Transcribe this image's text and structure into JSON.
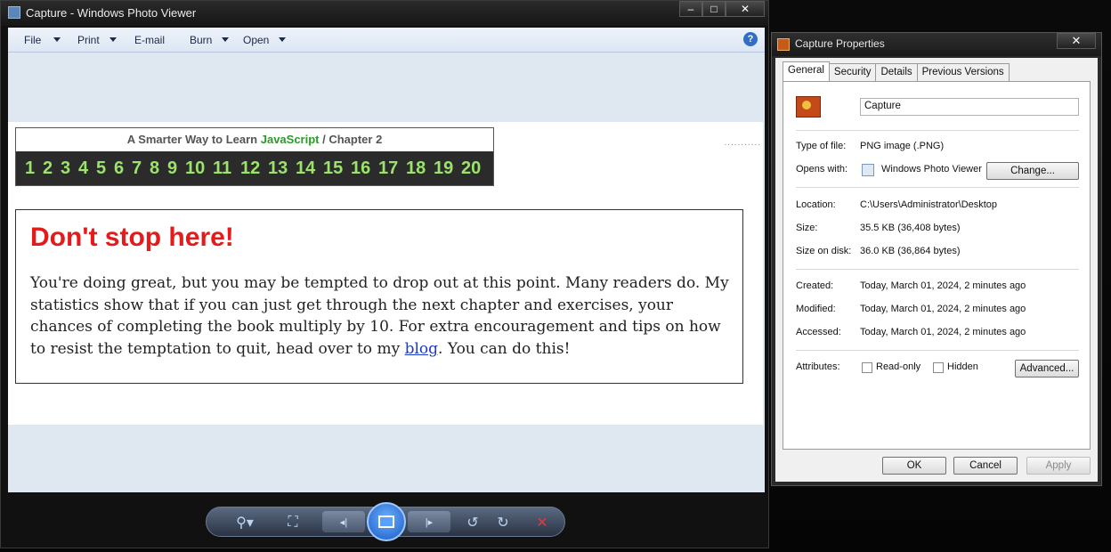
{
  "viewer": {
    "title": "Capture - Windows Photo Viewer",
    "window_buttons": {
      "minimize": "–",
      "maximize": "□",
      "close": "✕"
    },
    "menu": [
      {
        "label": "File",
        "has_dropdown": true
      },
      {
        "label": "Print",
        "has_dropdown": true
      },
      {
        "label": "E-mail",
        "has_dropdown": false
      },
      {
        "label": "Burn",
        "has_dropdown": true
      },
      {
        "label": "Open",
        "has_dropdown": true
      }
    ],
    "help": "?",
    "image": {
      "chapter_header_prefix": "A Smarter Way to Learn",
      "chapter_header_js": "JavaScript",
      "chapter_header_suffix": "/ Chapter 2",
      "chapter_numbers": [
        "1",
        "2",
        "3",
        "4",
        "5",
        "6",
        "7",
        "8",
        "9",
        "10",
        "11",
        "12",
        "13",
        "14",
        "15",
        "16",
        "17",
        "18",
        "19",
        "20"
      ],
      "dots": "...........",
      "heading": "Don't stop here!",
      "body_before_link": "You're doing great, but you may be tempted to drop out at this point. Many readers do. My statistics show that if you can just get through the next chapter and exercises, your chances of completing the book multiply by 10. For extra encouragement and tips on how to resist the temptation to quit, head over to my ",
      "link_text": "blog",
      "body_after_link": ". You can do this!"
    },
    "toolbar": {
      "zoom": "⚲▾",
      "fit": "⛶",
      "prev": "◂|",
      "next": "|▸",
      "rotate_ccw": "↺",
      "rotate_cw": "↻",
      "delete": "✕"
    }
  },
  "properties": {
    "title": "Capture Properties",
    "close": "✕",
    "tabs": [
      "General",
      "Security",
      "Details",
      "Previous Versions"
    ],
    "active_tab": "General",
    "filename": "Capture",
    "rows": {
      "type_label": "Type of file:",
      "type_value": "PNG image (.PNG)",
      "opens_label": "Opens with:",
      "opens_value": "Windows Photo Viewer",
      "change_button": "Change...",
      "location_label": "Location:",
      "location_value": "C:\\Users\\Administrator\\Desktop",
      "size_label": "Size:",
      "size_value": "35.5 KB (36,408 bytes)",
      "disk_label": "Size on disk:",
      "disk_value": "36.0 KB (36,864 bytes)",
      "created_label": "Created:",
      "created_value": "Today, March 01, 2024, 2 minutes ago",
      "modified_label": "Modified:",
      "modified_value": "Today, March 01, 2024, 2 minutes ago",
      "accessed_label": "Accessed:",
      "accessed_value": "Today, March 01, 2024, 2 minutes ago",
      "attributes_label": "Attributes:",
      "readonly": "Read-only",
      "hidden": "Hidden",
      "advanced_button": "Advanced..."
    },
    "buttons": {
      "ok": "OK",
      "cancel": "Cancel",
      "apply": "Apply"
    }
  }
}
